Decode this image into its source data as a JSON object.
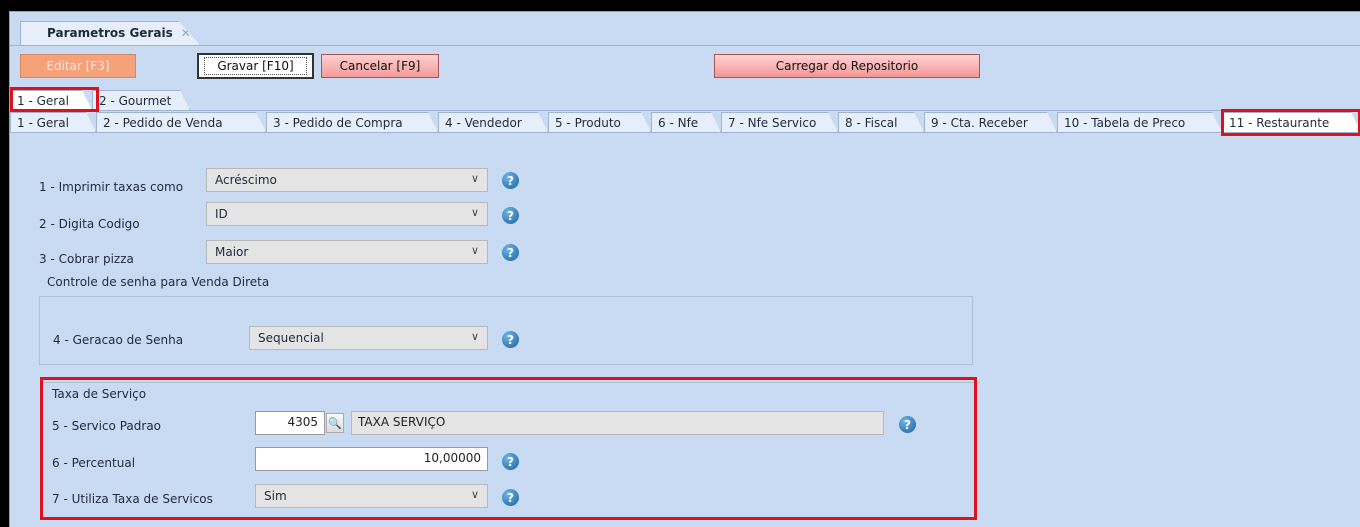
{
  "window": {
    "tab_title": "Parametros Gerais",
    "tab_close": "✕"
  },
  "toolbar": {
    "edit": "Editar [F3]",
    "save": "Gravar [F10]",
    "cancel": "Cancelar [F9]",
    "repo": "Carregar do Repositorio"
  },
  "outer_tabs": [
    "1 - Geral",
    "2 - Gourmet"
  ],
  "inner_tabs": [
    "1 - Geral",
    "2 - Pedido de Venda",
    "3 - Pedido de Compra",
    "4 - Vendedor",
    "5 - Produto",
    "6 - Nfe",
    "7 - Nfe Servico",
    "8 - Fiscal",
    "9 - Cta. Receber",
    "10 - Tabela de Preco",
    "11 - Restaurante"
  ],
  "fields": {
    "f1": {
      "label": "1 - Imprimir taxas como",
      "value": "Acréscimo"
    },
    "f2": {
      "label": "2 - Digita Codigo",
      "value": "ID"
    },
    "f3": {
      "label": "3 - Cobrar pizza",
      "value": "Maior"
    },
    "group_senha": "Controle de senha para Venda Direta",
    "f4": {
      "label": "4 - Geracao de Senha",
      "value": "Sequencial"
    },
    "group_taxa": "Taxa de Serviço",
    "f5": {
      "label": "5 - Servico Padrao",
      "code": "4305",
      "desc": "TAXA SERVIÇO"
    },
    "f6": {
      "label": "6 - Percentual",
      "value": "10,00000"
    },
    "f7": {
      "label": "7 - Utiliza Taxa de Servicos",
      "value": "Sim"
    }
  },
  "icons": {
    "chevron": "∨",
    "help": "?",
    "search": "🔍"
  },
  "colors": {
    "highlight": "#e0101c",
    "background": "#c9dbf3"
  }
}
